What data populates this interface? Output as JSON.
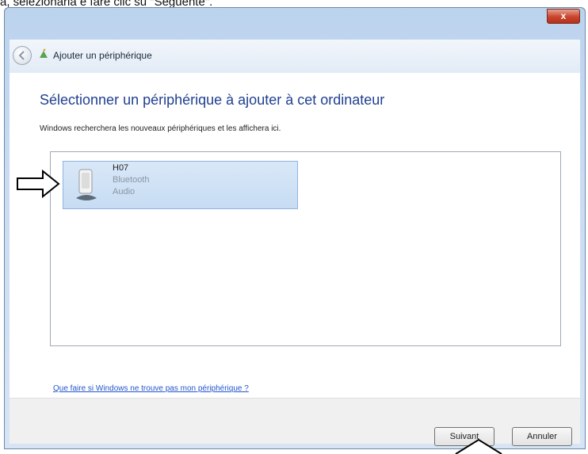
{
  "caption": "a, selezionarla e fare clic su \"Seguente\".",
  "window": {
    "close_glyph": "x",
    "title": "Ajouter un périphérique"
  },
  "content": {
    "heading": "Sélectionner un périphérique à ajouter à cet ordinateur",
    "subtext": "Windows recherchera les nouveaux périphériques et les affichera ici.",
    "devices": [
      {
        "name": "H07",
        "type": "Bluetooth",
        "class": "Audio"
      }
    ],
    "help_link": "Que faire si Windows ne trouve pas mon périphérique ?"
  },
  "footer": {
    "next_label": "Suivant",
    "cancel_label": "Annuler"
  },
  "colors": {
    "heading": "#1f3f8f",
    "selection": "#c7dcf3",
    "link": "#2255cc"
  }
}
